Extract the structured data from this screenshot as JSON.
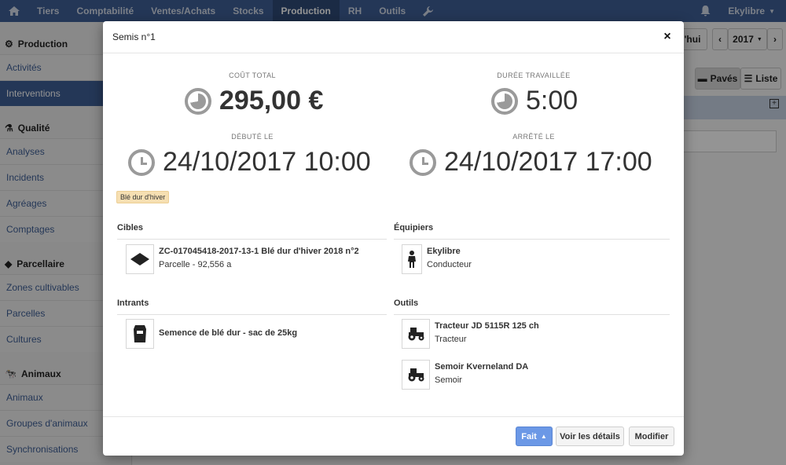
{
  "topnav": {
    "items": [
      "Tiers",
      "Comptabilité",
      "Ventes/Achats",
      "Stocks",
      "Production",
      "RH",
      "Outils"
    ],
    "active": "Production",
    "user": "Ekylibre"
  },
  "sidebar": {
    "sections": [
      {
        "title": "Production",
        "items": [
          "Activités",
          "Interventions"
        ]
      },
      {
        "title": "Qualité",
        "items": [
          "Analyses",
          "Incidents",
          "Agréages",
          "Comptages"
        ]
      },
      {
        "title": "Parcellaire",
        "items": [
          "Zones cultivables",
          "Parcelles",
          "Cultures"
        ]
      },
      {
        "title": "Animaux",
        "items": [
          "Animaux",
          "Groupes d'animaux",
          "Synchronisations"
        ]
      }
    ],
    "active_item": "Interventions"
  },
  "background": {
    "today_partial": "'hui",
    "year": "2017",
    "view_paves": "Pavés",
    "view_liste": "Liste"
  },
  "modal": {
    "title": "Semis n°1",
    "close": "×",
    "cost_label": "COÛT TOTAL",
    "cost_value": "295,00 €",
    "duration_label": "DURÉE TRAVAILLÉE",
    "duration_value": "5:00",
    "started_label": "DÉBUTÉ LE",
    "started_value": "24/10/2017 10:00",
    "stopped_label": "ARRÊTÉ LE",
    "stopped_value": "24/10/2017 17:00",
    "tag": "Blé dur d'hiver",
    "sections": {
      "cibles": {
        "title": "Cibles",
        "items": [
          {
            "name": "ZC-017045418-2017-13-1 Blé dur d'hiver 2018 n°2",
            "detail": "Parcelle - 92,556 a",
            "icon": "parcel-icon"
          }
        ]
      },
      "equipiers": {
        "title": "Équipiers",
        "items": [
          {
            "name": "Ekylibre",
            "detail": "Conducteur",
            "icon": "person-icon"
          }
        ]
      },
      "intrants": {
        "title": "Intrants",
        "items": [
          {
            "name": "Semence de blé dur - sac de 25kg",
            "detail": "",
            "icon": "seed-bag-icon"
          }
        ]
      },
      "outils": {
        "title": "Outils",
        "items": [
          {
            "name": "Tracteur JD 5115R 125 ch",
            "detail": "Tracteur",
            "icon": "tractor-icon"
          },
          {
            "name": "Semoir Kverneland DA",
            "detail": "Semoir",
            "icon": "tractor-icon"
          }
        ]
      }
    },
    "footer": {
      "done": "Fait",
      "details": "Voir les détails",
      "edit": "Modifier"
    }
  }
}
